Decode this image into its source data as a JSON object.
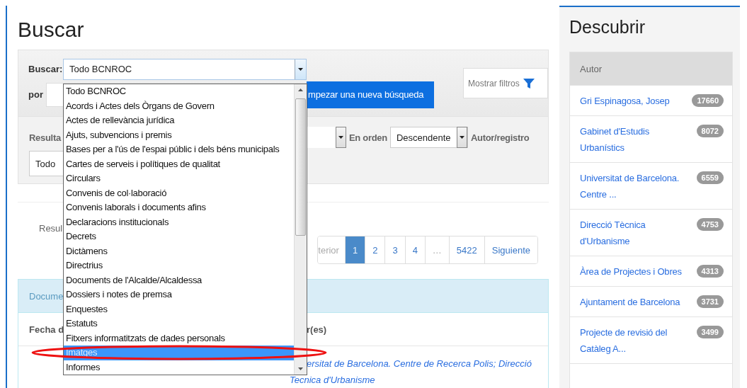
{
  "page_title": "Buscar",
  "search": {
    "label": "Buscar:",
    "scope": "Todo BCNROC",
    "por_label": "por",
    "new_search_button": "mpezar una nueva búsqueda",
    "filters_button": "Mostrar filtros"
  },
  "options": {
    "label_1": "Resulta",
    "order_label": "En orden",
    "order": "Descendente",
    "label_2": "Autor/registro",
    "per_page": "Todo"
  },
  "scope_dropdown": {
    "items": [
      {
        "label": "Todo BCNROC",
        "selected": false
      },
      {
        "label": "Acords i Actes dels Òrgans de Govern",
        "selected": false
      },
      {
        "label": "Actes de rellevància jurídica",
        "selected": false
      },
      {
        "label": "Ajuts, subvencions i premis",
        "selected": false
      },
      {
        "label": "Bases per a l'ús de l'espai públic i dels béns municipals",
        "selected": false
      },
      {
        "label": "Cartes de serveis i polítiques de qualitat",
        "selected": false
      },
      {
        "label": "Circulars",
        "selected": false
      },
      {
        "label": "Convenis de col·laboració",
        "selected": false
      },
      {
        "label": "Convenis laborals i documents afins",
        "selected": false
      },
      {
        "label": "Declaracions institucionals",
        "selected": false
      },
      {
        "label": "Decrets",
        "selected": false
      },
      {
        "label": "Dictàmens",
        "selected": false
      },
      {
        "label": "Directrius",
        "selected": false
      },
      {
        "label": "Documents de l'Alcalde/Alcaldessa",
        "selected": false
      },
      {
        "label": "Dossiers i notes de premsa",
        "selected": false
      },
      {
        "label": "Enquestes",
        "selected": false
      },
      {
        "label": "Estatuts",
        "selected": false
      },
      {
        "label": "Fitxers informatitzats de dades personals",
        "selected": false
      },
      {
        "label": "Imatges",
        "selected": true
      },
      {
        "label": "Informes",
        "selected": false
      }
    ]
  },
  "results": {
    "label": "Resul",
    "pagination": [
      {
        "kind": "prev",
        "label": "terior",
        "selected": false,
        "disabled": true
      },
      {
        "kind": "page",
        "label": "1",
        "selected": true,
        "disabled": false
      },
      {
        "kind": "page",
        "label": "2",
        "selected": false,
        "disabled": false
      },
      {
        "kind": "page",
        "label": "3",
        "selected": false,
        "disabled": false
      },
      {
        "kind": "page",
        "label": "4",
        "selected": false,
        "disabled": false
      },
      {
        "kind": "ellipsis",
        "label": "…",
        "selected": false,
        "disabled": true
      },
      {
        "kind": "page",
        "label": "5422",
        "selected": false,
        "disabled": false
      },
      {
        "kind": "next",
        "label": "Siguiente",
        "selected": false,
        "disabled": false
      }
    ]
  },
  "documents_panel": {
    "title": "Docume",
    "columns": [
      "Fecha d",
      "r(es)"
    ],
    "rows": [
      {
        "authors": [
          "ersitat de Barcelona. Centre de Recerca Polis; Direcció",
          "Tecnica d'Urbanisme"
        ]
      }
    ]
  },
  "sidebar": {
    "title": "Descubrir",
    "facet": {
      "title": "Autor",
      "items": [
        {
          "label": "Gri Espinagosa, Josep",
          "count": "17660"
        },
        {
          "label": "Gabinet d'Estudis Urbanístics",
          "count": "8072"
        },
        {
          "label": "Universitat de Barcelona. Centre ...",
          "count": "6559"
        },
        {
          "label": "Direcció Tècnica d'Urbanisme",
          "count": "4753"
        },
        {
          "label": "Àrea de Projectes i Obres",
          "count": "4313"
        },
        {
          "label": "Ajuntament de Barcelona",
          "count": "3731"
        },
        {
          "label": "Projecte de revisió del Catàleg A...",
          "count": "3499"
        }
      ]
    }
  }
}
